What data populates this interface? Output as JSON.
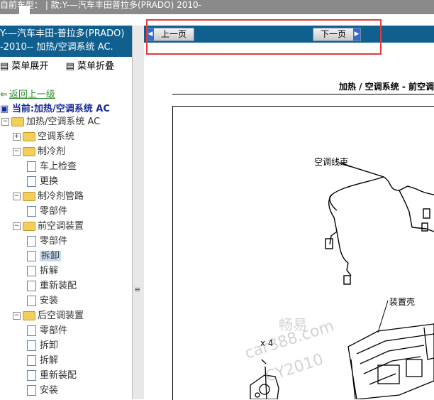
{
  "window": {
    "title_bar": "自前车型：  |  款:Y-—汽车丰田普拉多(PRADO) 2010-"
  },
  "left_panel": {
    "header_line1": "Y-—汽车丰田-普拉多(PRADO)",
    "header_line2": "-2010-- 加热/空调系统 AC.",
    "expand_label": "菜单展开",
    "collapse_label": "菜单折叠",
    "back_label": "返回上一级",
    "current_label": "当前:加热/空调系统 AC",
    "tree": [
      {
        "label": "加热/空调系统 AC",
        "type": "folder",
        "toggle": "−",
        "level": 0
      },
      {
        "label": "空调系统",
        "type": "folder",
        "toggle": "+",
        "level": 1
      },
      {
        "label": "制冷剂",
        "type": "folder",
        "toggle": "−",
        "level": 1
      },
      {
        "label": "车上检查",
        "type": "doc",
        "level": 2
      },
      {
        "label": "更换",
        "type": "doc",
        "level": 2
      },
      {
        "label": "制冷剂管路",
        "type": "folder",
        "toggle": "−",
        "level": 1
      },
      {
        "label": "零部件",
        "type": "doc",
        "level": 2
      },
      {
        "label": "前空调装置",
        "type": "folder",
        "toggle": "−",
        "level": 1
      },
      {
        "label": "零部件",
        "type": "doc",
        "level": 2
      },
      {
        "label": "拆卸",
        "type": "doc",
        "level": 2,
        "selected": true
      },
      {
        "label": "拆解",
        "type": "doc",
        "level": 2
      },
      {
        "label": "重新装配",
        "type": "doc",
        "level": 2
      },
      {
        "label": "安装",
        "type": "doc",
        "level": 2
      },
      {
        "label": "后空调装置",
        "type": "folder",
        "toggle": "−",
        "level": 1
      },
      {
        "label": "零部件",
        "type": "doc",
        "level": 2
      },
      {
        "label": "拆卸",
        "type": "doc",
        "level": 2
      },
      {
        "label": "拆解",
        "type": "doc",
        "level": 2
      },
      {
        "label": "重新装配",
        "type": "doc",
        "level": 2
      },
      {
        "label": "安装",
        "type": "doc",
        "level": 2
      }
    ]
  },
  "nav": {
    "prev_label": "上一页",
    "next_label": "下一页"
  },
  "document": {
    "section_title": "加热 / 空调系统  -  前空调",
    "labels": {
      "harness": "空调线束",
      "housing": "装置壳",
      "qty": "x 4"
    },
    "watermark": {
      "line1": "畅易",
      "line2": "car388.com",
      "line3": "CY2010"
    }
  },
  "colors": {
    "header_blue": "#0f5f8f",
    "highlight_red": "#e23a3a",
    "link_green": "#2f8a2f",
    "current_blue": "#1a2a9a"
  }
}
